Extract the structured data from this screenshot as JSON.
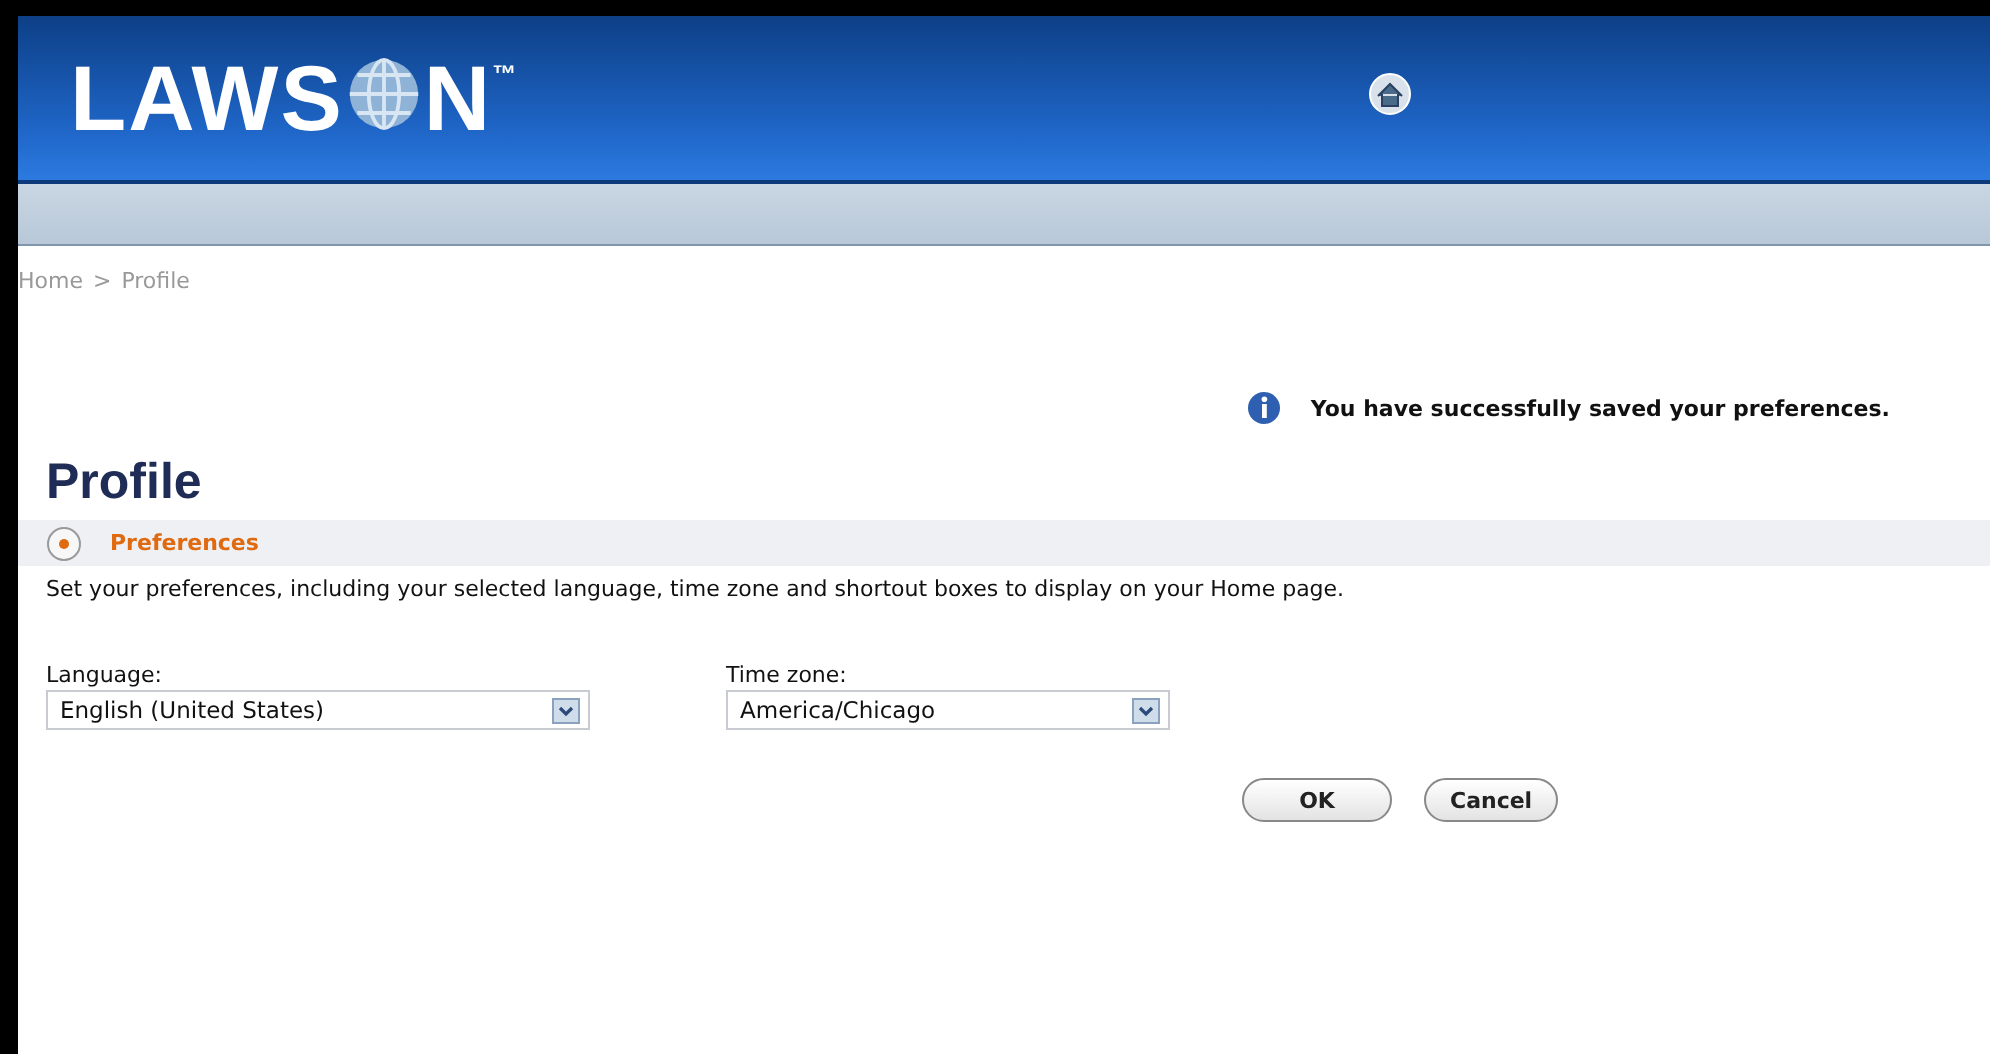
{
  "header": {
    "logo_before": "LAWS",
    "logo_after": "N",
    "logo_mark": "™"
  },
  "breadcrumb": [
    {
      "label": "Home"
    },
    {
      "label": ">"
    },
    {
      "label": "Profile"
    }
  ],
  "message": "You have successfully saved your preferences.",
  "page_title": "Profile",
  "section": {
    "title": "Preferences",
    "expanded": true
  },
  "description": "Set your preferences, including your selected language, time zone and shortout boxes to display on your Home page.",
  "fields": [
    {
      "label": "Language:",
      "value": "English (United States)"
    },
    {
      "label": "Time zone:",
      "value": "America/Chicago"
    }
  ],
  "buttons": [
    "OK",
    "Cancel"
  ]
}
